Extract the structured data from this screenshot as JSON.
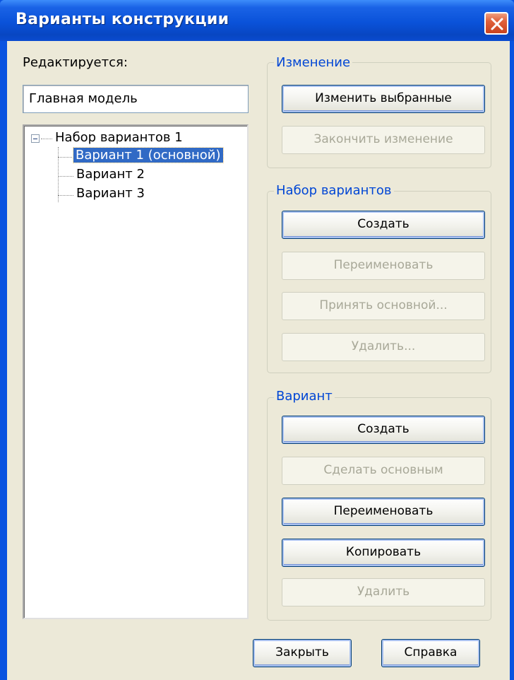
{
  "window": {
    "title": "Варианты конструкции"
  },
  "editing": {
    "label": "Редактируется:",
    "value": "Главная модель"
  },
  "tree": {
    "root": "Набор вариантов 1",
    "items": [
      {
        "label": "Вариант 1 (основной)",
        "selected": true
      },
      {
        "label": "Вариант 2",
        "selected": false
      },
      {
        "label": "Вариант 3",
        "selected": false
      }
    ]
  },
  "group_change": {
    "title": "Изменение",
    "buttons": [
      {
        "label": "Изменить выбранные",
        "enabled": true
      },
      {
        "label": "Закончить изменение",
        "enabled": false
      }
    ]
  },
  "group_set": {
    "title": "Набор вариантов",
    "buttons": [
      {
        "label": "Создать",
        "enabled": true
      },
      {
        "label": "Переименовать",
        "enabled": false
      },
      {
        "label": "Принять основной...",
        "enabled": false
      },
      {
        "label": "Удалить...",
        "enabled": false
      }
    ]
  },
  "group_option": {
    "title": "Вариант",
    "buttons": [
      {
        "label": "Создать",
        "enabled": true
      },
      {
        "label": "Сделать основным",
        "enabled": false
      },
      {
        "label": "Переименовать",
        "enabled": true
      },
      {
        "label": "Копировать",
        "enabled": true
      },
      {
        "label": "Удалить",
        "enabled": false
      }
    ]
  },
  "footer": {
    "close_label": "Закрыть",
    "help_label": "Справка"
  },
  "colors": {
    "titlebar": "#0a52d9",
    "selection": "#316ac5",
    "group_title": "#0046d5",
    "dialog_bg": "#ece9d8"
  }
}
